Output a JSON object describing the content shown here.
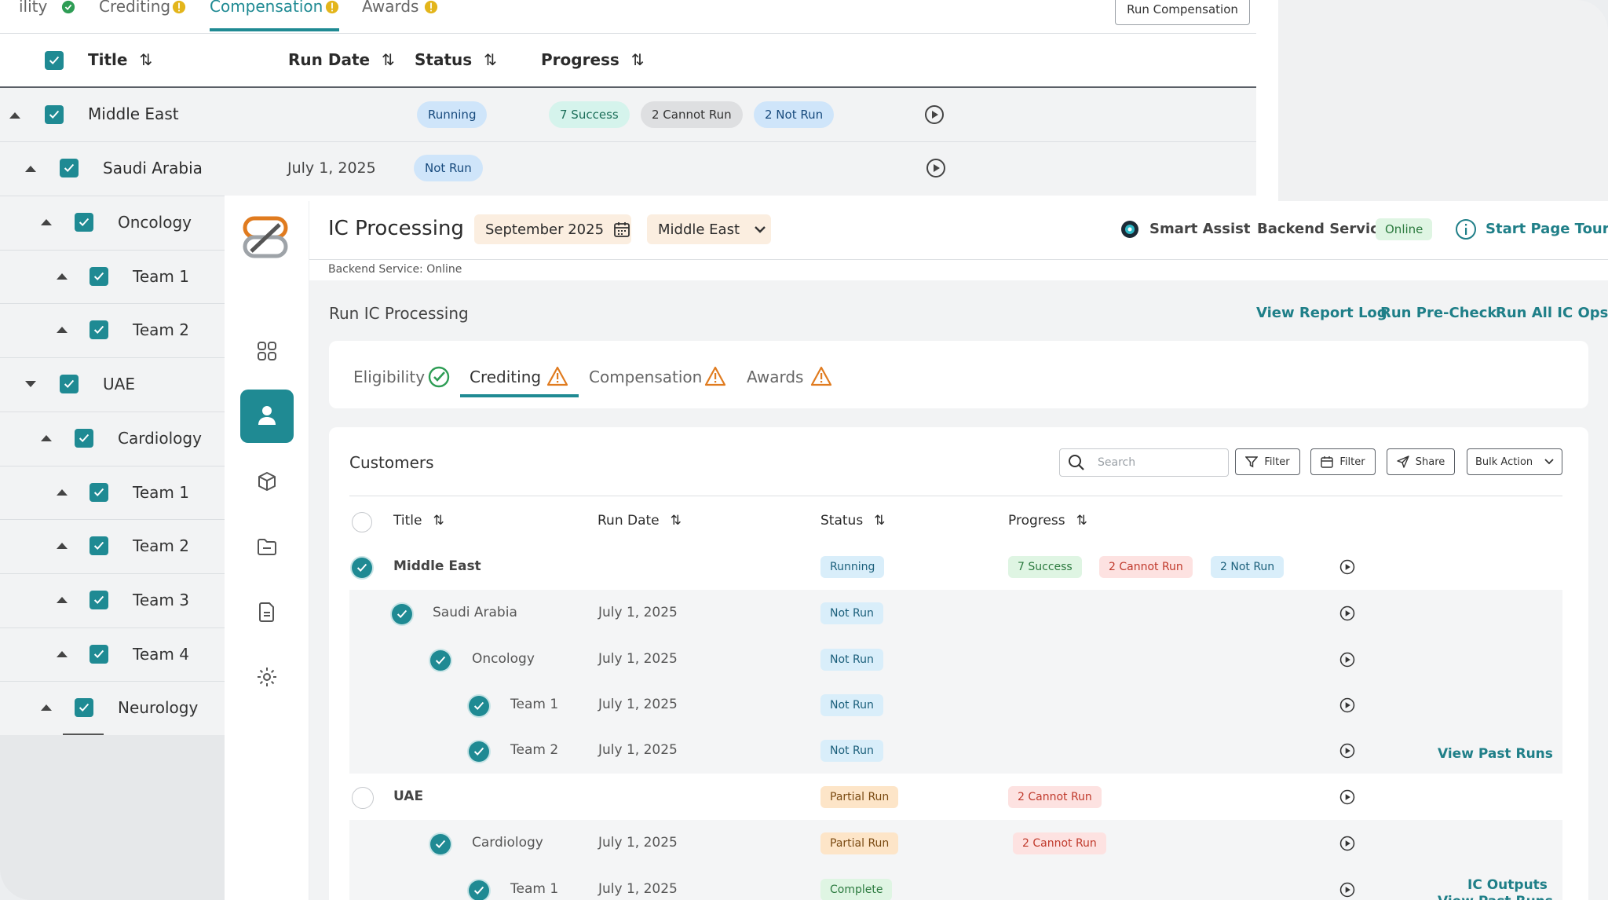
{
  "back": {
    "tabs": [
      {
        "label": "ility",
        "status": "ok"
      },
      {
        "label": "Crediting",
        "status": "warn"
      },
      {
        "label": "Compensation",
        "status": "warn",
        "active": true
      },
      {
        "label": "Awards",
        "status": "warn"
      }
    ],
    "run_button": "Run Compensation",
    "columns": {
      "title": "Title",
      "run_date": "Run Date",
      "status": "Status",
      "progress": "Progress"
    },
    "rows": [
      {
        "title": "Middle East",
        "status": "Running",
        "progress": [
          "7 Success",
          "2 Cannot Run",
          "2 Not Run"
        ]
      },
      {
        "title": "Saudi Arabia",
        "date": "July 1, 2025",
        "status": "Not Run"
      },
      {
        "title": "Oncology"
      },
      {
        "title": "Team 1"
      },
      {
        "title": "Team 2"
      },
      {
        "title": "UAE"
      },
      {
        "title": "Cardiology"
      },
      {
        "title": "Team 1"
      },
      {
        "title": "Team 2"
      },
      {
        "title": "Team 3"
      },
      {
        "title": "Team 4"
      },
      {
        "title": "Neurology"
      }
    ]
  },
  "front": {
    "header": {
      "title": "IC Processing",
      "date": "September 2025",
      "region": "Middle East",
      "smart_assist": "Smart Assist",
      "backend_label": "Backend Service",
      "backend_status": "Online",
      "tour": "Start Page Tour",
      "sub_status": "Backend Service: Online"
    },
    "section_title": "Run IC Processing",
    "actions": [
      "View Report Log",
      "Run Pre-Check",
      "Run All IC Ops"
    ],
    "tabs": [
      {
        "label": "Eligibility",
        "status": "ok"
      },
      {
        "label": "Crediting",
        "status": "warn",
        "active": true
      },
      {
        "label": "Compensation",
        "status": "warn"
      },
      {
        "label": "Awards",
        "status": "warn"
      }
    ],
    "card_title": "Customers",
    "search_placeholder": "Search",
    "toolbar": {
      "filter1": "Filter",
      "filter2": "Filter",
      "share": "Share",
      "bulk": "Bulk Action"
    },
    "columns": {
      "title": "Title",
      "run_date": "Run Date",
      "status": "Status",
      "progress": "Progress"
    },
    "rows": [
      {
        "title": "Middle East",
        "status": "Running",
        "progress": [
          "7 Success",
          "2 Cannot Run",
          "2 Not Run"
        ]
      },
      {
        "title": "Saudi Arabia",
        "date": "July 1, 2025",
        "status": "Not Run"
      },
      {
        "title": "Oncology",
        "date": "July 1, 2025",
        "status": "Not Run"
      },
      {
        "title": "Team 1",
        "date": "July 1, 2025",
        "status": "Not Run"
      },
      {
        "title": "Team 2",
        "date": "July 1, 2025",
        "status": "Not Run"
      },
      {
        "title": "UAE",
        "status": "Partial Run",
        "progress": [
          "2 Cannot Run"
        ]
      },
      {
        "title": "Cardiology",
        "date": "July 1, 2025",
        "status": "Partial Run",
        "progress": [
          "2 Cannot Run"
        ]
      },
      {
        "title": "Team 1",
        "date": "July 1, 2025",
        "status": "Complete"
      }
    ],
    "side_links": [
      "View Past Runs",
      "IC Outputs",
      "View Past Runs"
    ]
  }
}
